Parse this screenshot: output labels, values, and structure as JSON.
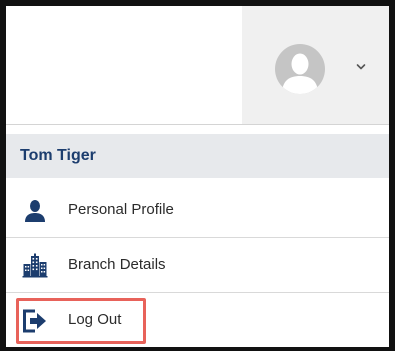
{
  "user_menu": {
    "avatar_icon": "user-avatar-icon",
    "caret_icon": "chevron-down-icon",
    "user_name": "Tom Tiger",
    "items": [
      {
        "label": "Personal Profile",
        "icon": "person-icon"
      },
      {
        "label": "Branch Details",
        "icon": "buildings-icon"
      },
      {
        "label": "Log Out",
        "icon": "logout-icon"
      }
    ],
    "highlight_color": "#e8625a",
    "user_name_color": "#1c3d6e",
    "icon_color": "#1c3d6e"
  }
}
